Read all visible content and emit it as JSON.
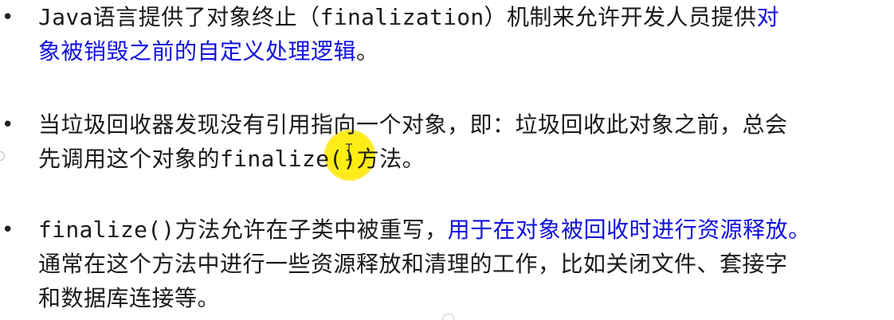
{
  "bullets": [
    {
      "marker": "•",
      "segments": [
        {
          "text": "Java",
          "mono": true,
          "blue": false
        },
        {
          "text": "语言提供了对象终止（",
          "mono": false,
          "blue": false
        },
        {
          "text": "finalization",
          "mono": true,
          "blue": false
        },
        {
          "text": "）机制来允许开发人员提供",
          "mono": false,
          "blue": false
        },
        {
          "text": "对",
          "mono": false,
          "blue": true
        },
        {
          "text": "\n",
          "newline": true
        },
        {
          "text": "象被销毁之前的自定义处理逻辑",
          "mono": false,
          "blue": true
        },
        {
          "text": "。",
          "mono": false,
          "blue": false
        }
      ]
    },
    {
      "marker": "•",
      "segments": [
        {
          "text": "当垃圾回收器发现没有引用指向一个对象，即：垃圾回收此对象之前，总会",
          "mono": false,
          "blue": false
        },
        {
          "text": "\n",
          "newline": true
        },
        {
          "text": "先调用这个对象的",
          "mono": false,
          "blue": false
        },
        {
          "text": "finalize()",
          "mono": true,
          "blue": false
        },
        {
          "text": "方法。",
          "mono": false,
          "blue": false
        }
      ]
    },
    {
      "marker": "•",
      "segments": [
        {
          "text": "finalize()",
          "mono": true,
          "blue": false
        },
        {
          "text": "方法允许在子类中被重写，",
          "mono": false,
          "blue": false
        },
        {
          "text": "用于在对象被回收时进行资源释放。",
          "mono": false,
          "blue": true
        },
        {
          "text": "\n",
          "newline": true
        },
        {
          "text": "通常在这个方法中进行一些资源释放和清理的工作，比如关闭文件、套接字",
          "mono": false,
          "blue": false
        },
        {
          "text": "\n",
          "newline": true
        },
        {
          "text": "和数据库连接等。",
          "mono": false,
          "blue": false
        }
      ]
    }
  ],
  "colors": {
    "text": "#1a1a1a",
    "highlight_blue": "#1010e0",
    "cursor_highlight": "#ffe800",
    "background": "#ffffff"
  },
  "cursor": {
    "icon": "text-ibeam-cursor-icon"
  }
}
